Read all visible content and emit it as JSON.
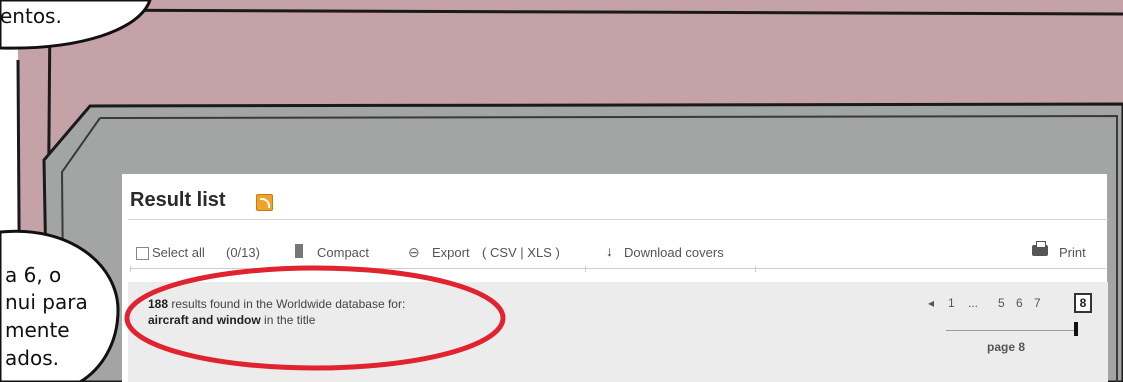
{
  "bubbles": {
    "top_text": "entos.",
    "side_lines": [
      "a 6, o",
      "nui para",
      "mente",
      "ados."
    ]
  },
  "result_list": {
    "title": "Result list",
    "rss_icon": "rss-icon"
  },
  "toolbar": {
    "select_all": "Select all",
    "select_count": "(0/13)",
    "compact": "Compact",
    "export": "Export",
    "export_formats": "( CSV | XLS )",
    "download": "Download covers",
    "print": "Print"
  },
  "results": {
    "count": "188",
    "text_middle": "results found in the Worldwide database for:",
    "query": "aircraft and window",
    "text_end": "in the title"
  },
  "pagination": {
    "first": "1",
    "ellipsis": "...",
    "pages": [
      "5",
      "6",
      "7"
    ],
    "current": "8",
    "label": "page 8"
  },
  "colors": {
    "pink_panel": "#c4a2a8",
    "gray_panel": "#a3a5a4",
    "annotation_red": "#e0232e",
    "rss_orange": "#f1a22a"
  }
}
